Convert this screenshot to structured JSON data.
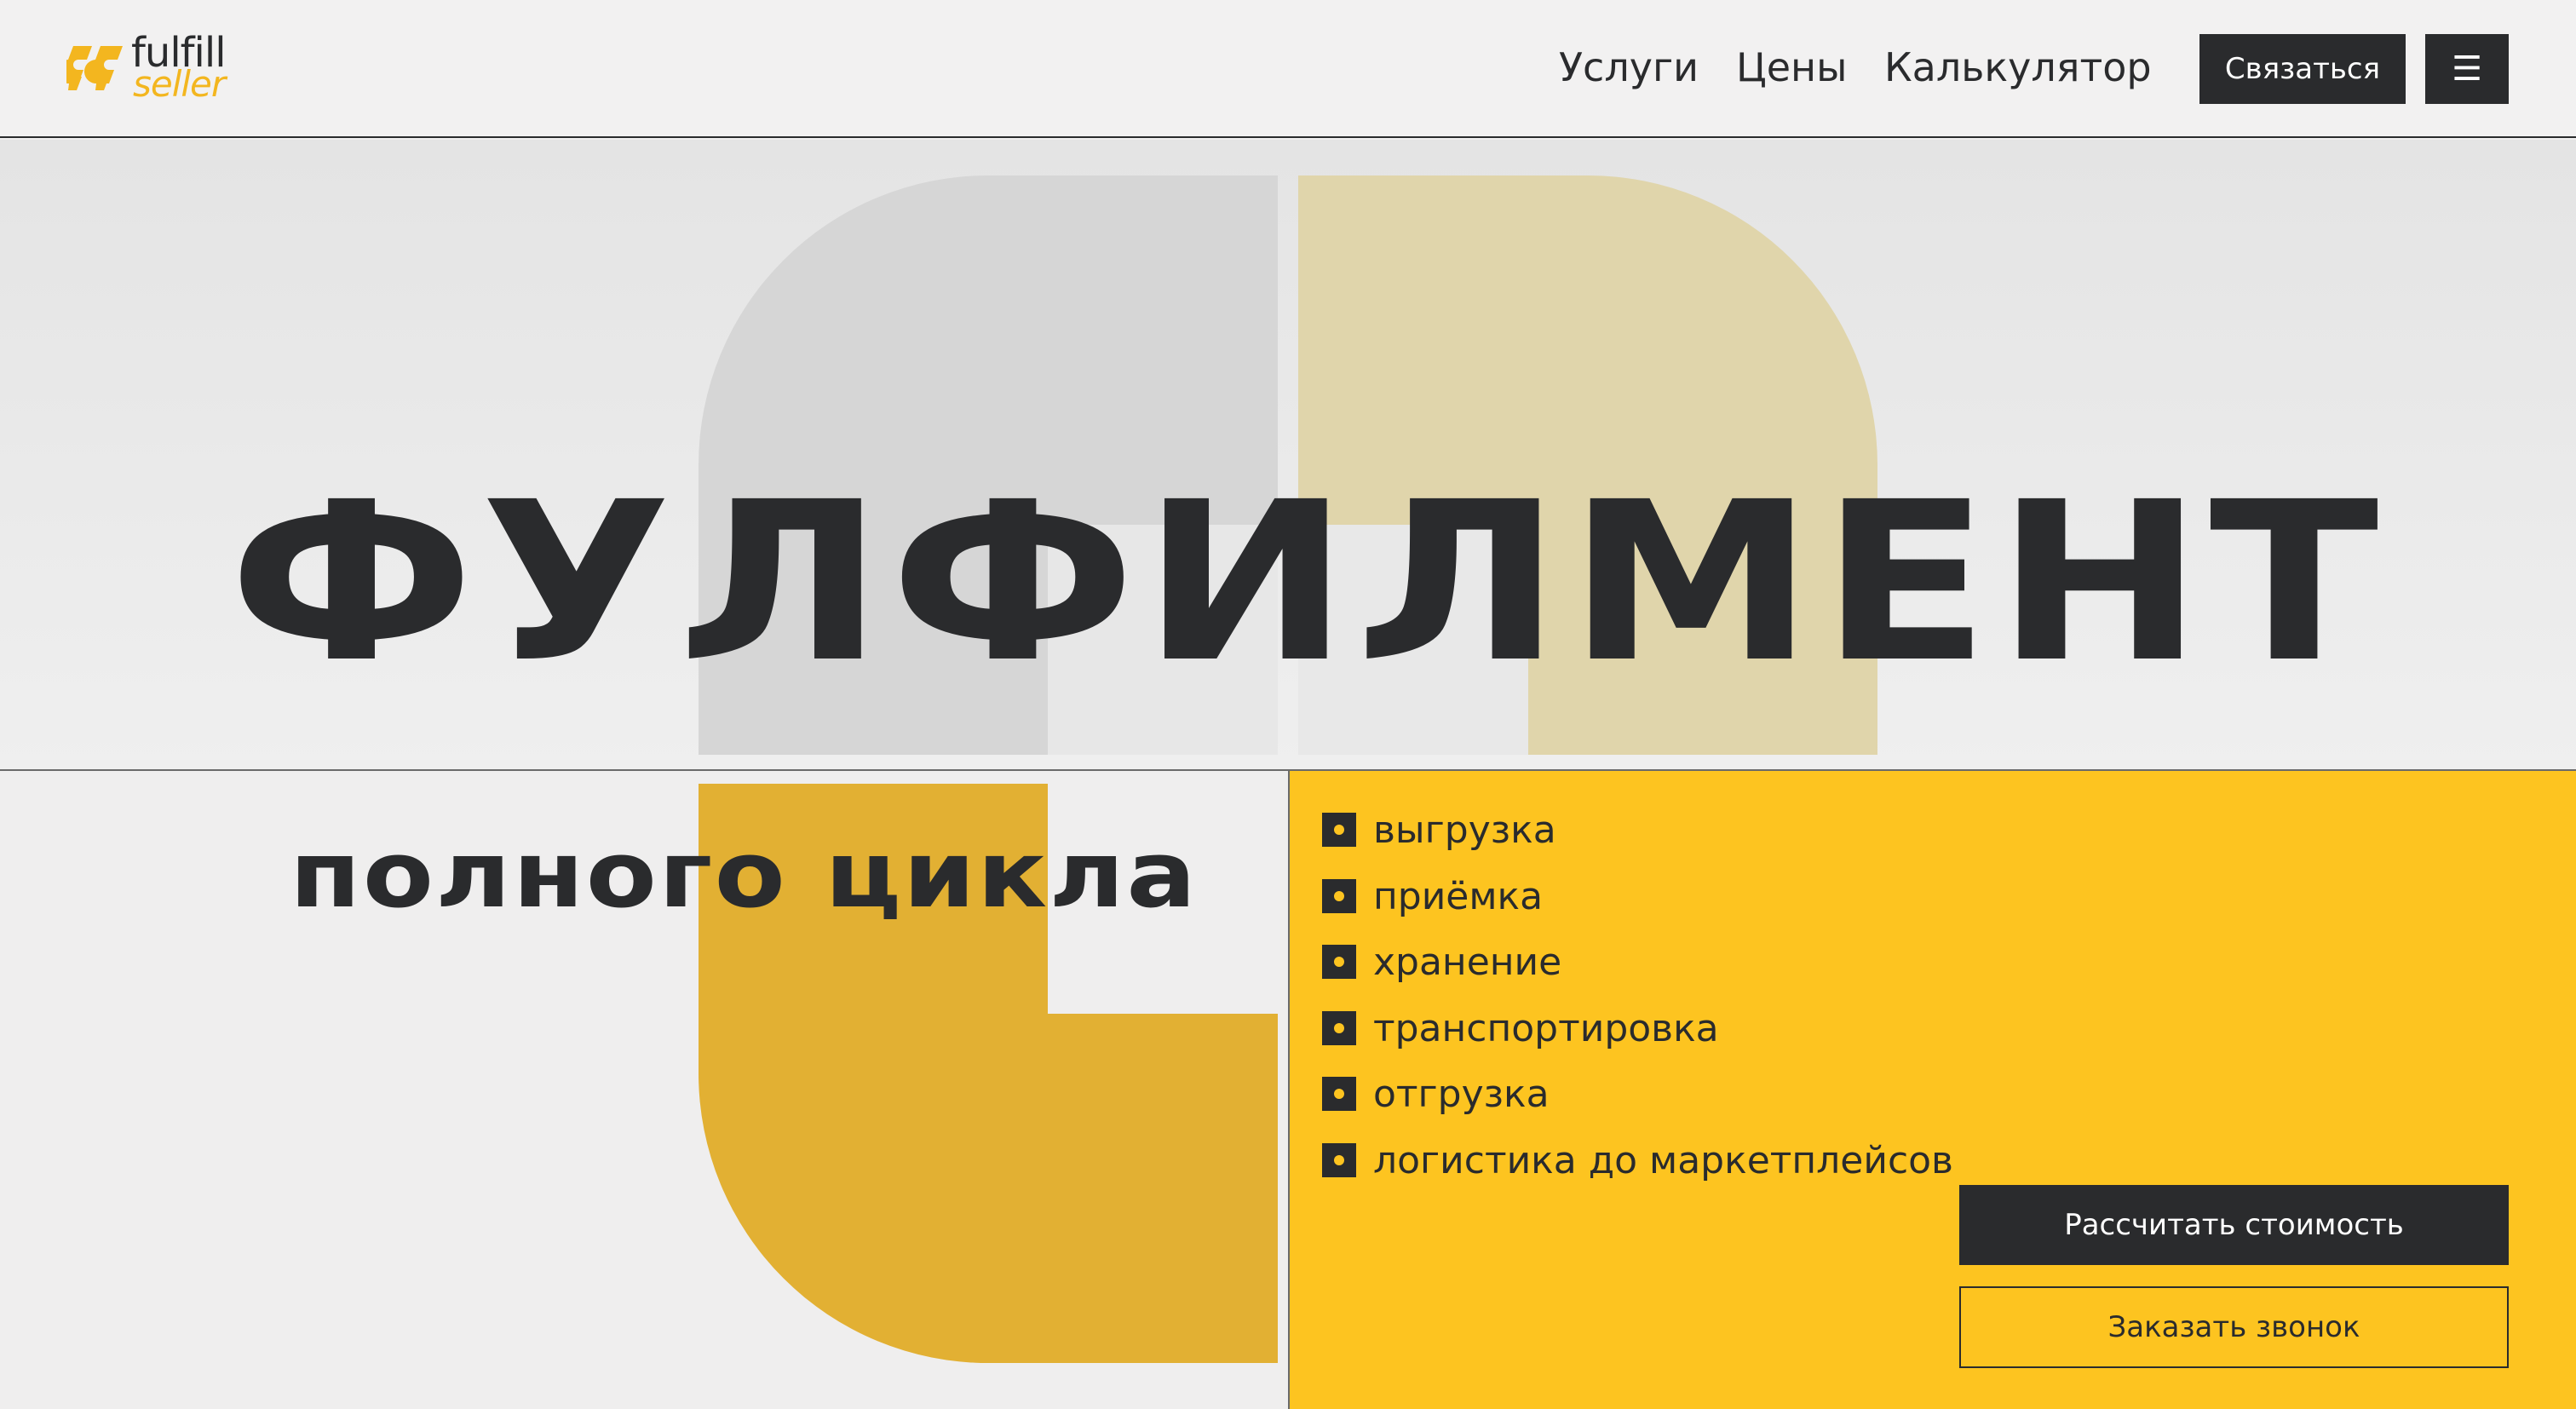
{
  "header": {
    "logo": {
      "line1": "fulfill",
      "line2": "seller"
    },
    "nav": [
      {
        "label": "Услуги"
      },
      {
        "label": "Цены"
      },
      {
        "label": "Калькулятор"
      }
    ],
    "contact_label": "Связаться",
    "menu_icon": "hamburger-icon"
  },
  "hero": {
    "title": "ФУЛФИЛМЕНТ",
    "subtitle": "полного цикла"
  },
  "services": [
    "выгрузка",
    "приёмка",
    "хранение",
    "транспортировка",
    "отгрузка",
    "логистика до маркетплейсов"
  ],
  "actions": {
    "calc_label": "Рассчитать стоимость",
    "call_label": "Заказать звонок"
  },
  "colors": {
    "dark": "#2a2b2d",
    "yellow": "#fdc420",
    "orange": "#e2b033",
    "beige": "#e0d5ab"
  }
}
